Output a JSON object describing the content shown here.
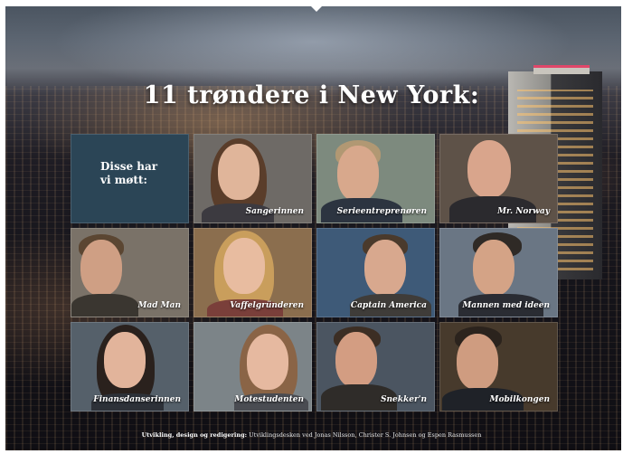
{
  "title": "11 trøndere i New York:",
  "intro": {
    "line1": "Disse har",
    "line2": "vi møtt:"
  },
  "people": [
    {
      "name": "Sangerinnen"
    },
    {
      "name": "Serieentreprenøren"
    },
    {
      "name": "Mr. Norway"
    },
    {
      "name": "Mad Man"
    },
    {
      "name": "Vaffelgründeren"
    },
    {
      "name": "Captain America"
    },
    {
      "name": "Mannen med ideen"
    },
    {
      "name": "Finansdanserinnen"
    },
    {
      "name": "Motestudenten"
    },
    {
      "name": "Snekker'n"
    },
    {
      "name": "Mobilkongen"
    }
  ],
  "credits": {
    "label": "Utvikling, design og redigering:",
    "text": "Utviklingsdesken ved Jonas Nilsson, Christer S. Johnsen og Espen Rasmussen"
  }
}
